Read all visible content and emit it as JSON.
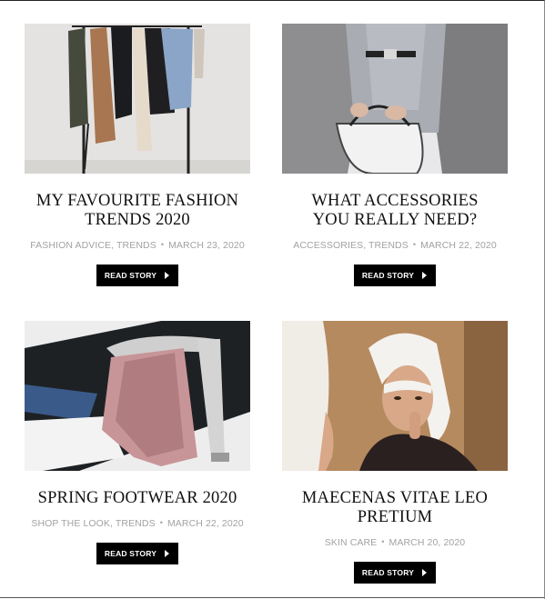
{
  "posts": [
    {
      "title": "MY FAVOURITE FASHION TRENDS 2020",
      "categories": [
        "FASHION ADVICE",
        "TRENDS"
      ],
      "date": "MARCH 23, 2020",
      "button": "READ STORY",
      "image_icon": "clothes-rack-image"
    },
    {
      "title": "WHAT ACCESSORIES YOU REALLY NEED?",
      "categories": [
        "ACCESSORIES",
        "TRENDS"
      ],
      "date": "MARCH 22, 2020",
      "button": "READ STORY",
      "image_icon": "handbag-model-image"
    },
    {
      "title": "SPRING FOOTWEAR 2020",
      "categories": [
        "SHOP THE LOOK",
        "TRENDS"
      ],
      "date": "MARCH 22, 2020",
      "button": "READ STORY",
      "image_icon": "feather-heel-image"
    },
    {
      "title": "MAECENAS VITAE LEO PRETIUM",
      "categories": [
        "SKIN CARE"
      ],
      "date": "MARCH 20, 2020",
      "button": "READ STORY",
      "image_icon": "makeup-mirror-image"
    }
  ],
  "separators": {
    "category": ", ",
    "meta": "•"
  },
  "colors": {
    "button_bg": "#000000",
    "meta_text": "#a2a2a2",
    "title_text": "#111111"
  }
}
